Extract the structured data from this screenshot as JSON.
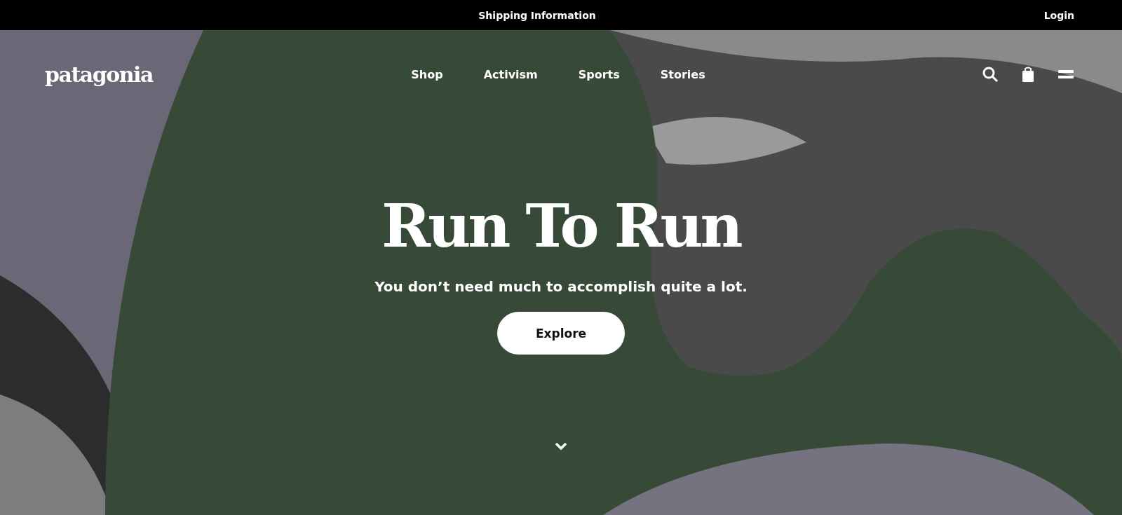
{
  "top_bar": {
    "shipping_link": "Shipping Information",
    "login_link": "Login"
  },
  "header": {
    "logo": "patagonia",
    "nav": [
      {
        "label": "Shop"
      },
      {
        "label": "Activism"
      },
      {
        "label": "Sports"
      },
      {
        "label": "Stories"
      }
    ]
  },
  "hero": {
    "title": "Run To Run",
    "subtitle": "You don’t need much to accomplish quite a lot.",
    "button": "Explore"
  }
}
